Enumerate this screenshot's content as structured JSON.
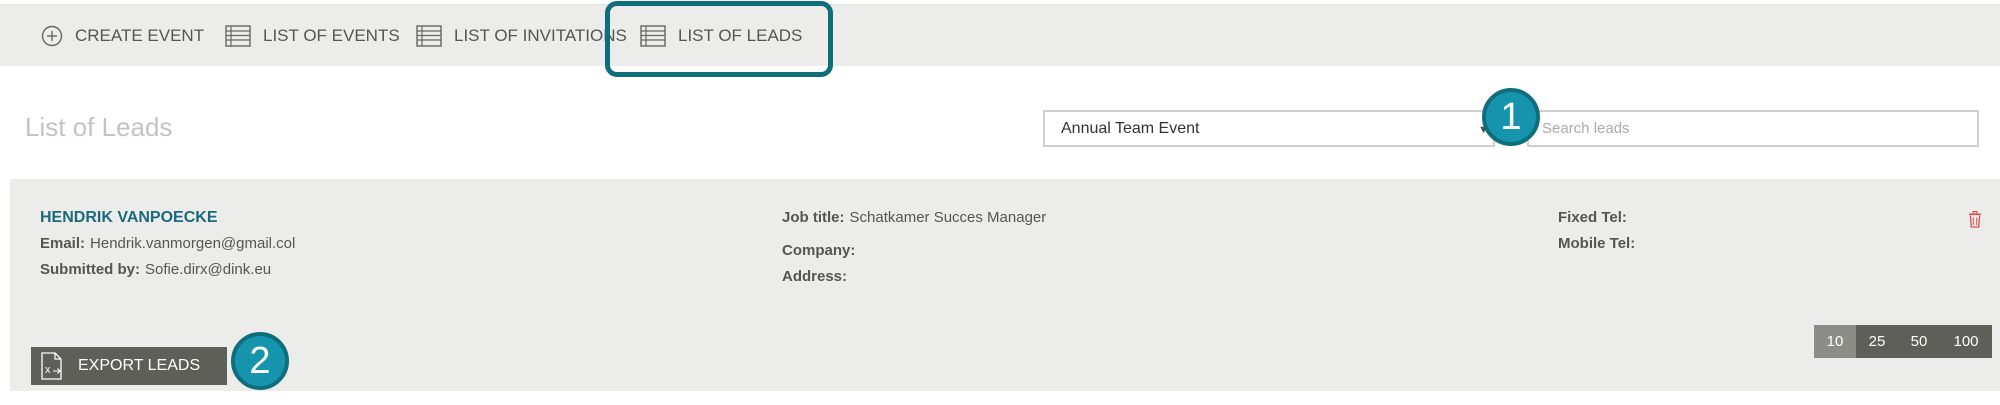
{
  "nav": {
    "items": [
      {
        "label": "CREATE EVENT",
        "icon": "plus-circle-icon"
      },
      {
        "label": "LIST OF EVENTS",
        "icon": "list-table-icon"
      },
      {
        "label": "LIST OF INVITATIONS",
        "icon": "list-table-icon"
      },
      {
        "label": "LIST OF LEADS",
        "icon": "list-table-icon",
        "active": true
      }
    ]
  },
  "page": {
    "title": "List of Leads"
  },
  "filters": {
    "event_selected": "Annual Team Event",
    "search_placeholder": "Search leads"
  },
  "callouts": {
    "first": "1",
    "second": "2"
  },
  "lead": {
    "name": "HENDRIK VANPOECKE",
    "email_label": "Email:",
    "email": "Hendrik.vanmorgen@gmail.col",
    "submitted_label": "Submitted by:",
    "submitted_by": "Sofie.dirx@dink.eu",
    "job_label": "Job title:",
    "job_title": "Schatkamer Succes Manager",
    "company_label": "Company:",
    "company": "",
    "address_label": "Address:",
    "address": "",
    "fixed_tel_label": "Fixed Tel:",
    "fixed_tel": "",
    "mobile_tel_label": "Mobile Tel:",
    "mobile_tel": ""
  },
  "actions": {
    "export_label": "EXPORT LEADS",
    "export_icon": "excel-export-icon",
    "delete_icon": "trash-icon"
  },
  "pagination": {
    "sizes": [
      "10",
      "25",
      "50",
      "100"
    ],
    "active": "10"
  },
  "colors": {
    "accent": "#1a6a7c",
    "highlight_border": "#0e6e7c",
    "callout_fill": "#1694ad",
    "panel_bg": "#ececea",
    "button_bg": "#5e5f59",
    "delete_red": "#d9534f"
  }
}
